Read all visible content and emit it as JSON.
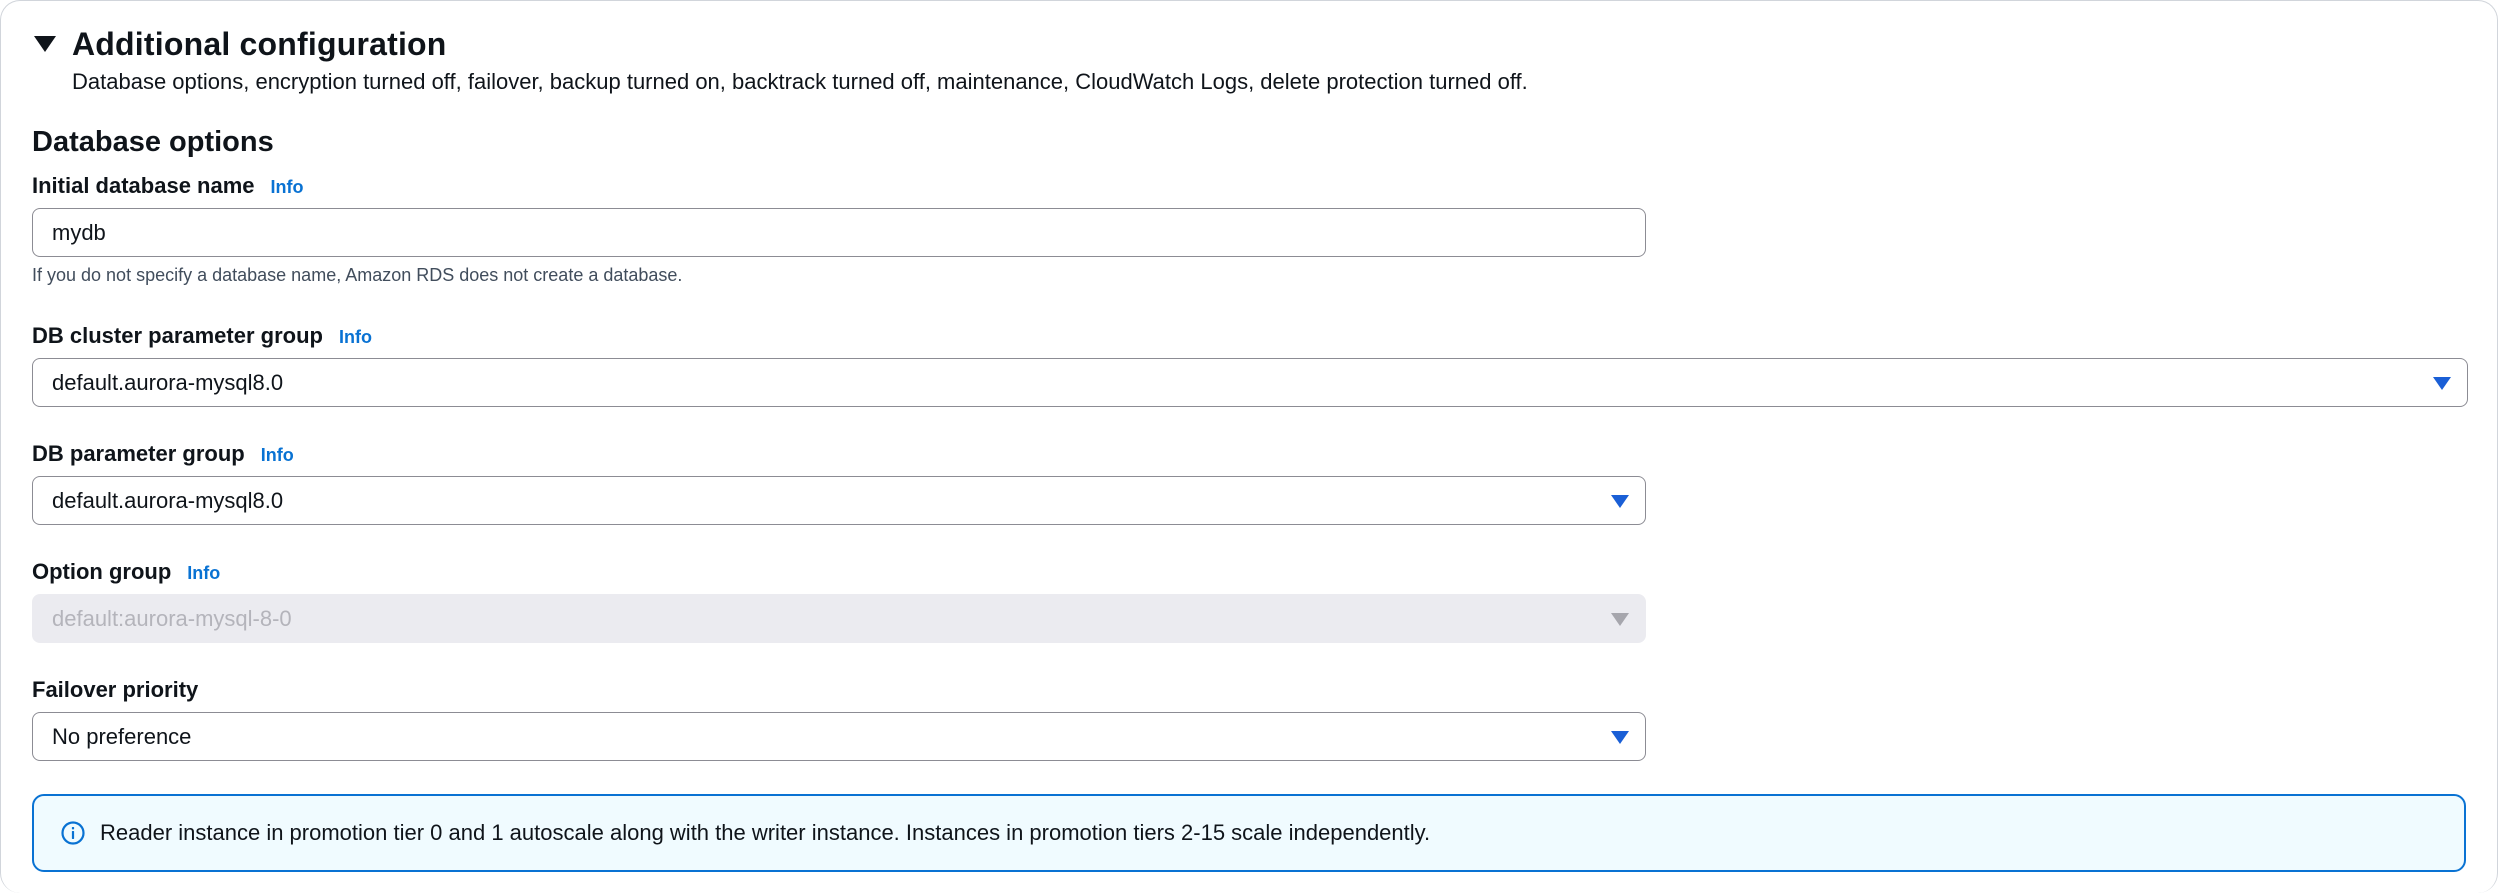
{
  "section": {
    "title": "Additional configuration",
    "description": "Database options, encryption turned off, failover, backup turned on, backtrack turned off, maintenance, CloudWatch Logs, delete protection turned off.",
    "expanded": true
  },
  "database_options": {
    "title": "Database options",
    "initial_db_name": {
      "label": "Initial database name",
      "info": "Info",
      "value": "mydb",
      "hint": "If you do not specify a database name, Amazon RDS does not create a database."
    },
    "cluster_param_group": {
      "label": "DB cluster parameter group",
      "info": "Info",
      "value": "default.aurora-mysql8.0"
    },
    "db_param_group": {
      "label": "DB parameter group",
      "info": "Info",
      "value": "default.aurora-mysql8.0"
    },
    "option_group": {
      "label": "Option group",
      "info": "Info",
      "value": "default:aurora-mysql-8-0",
      "disabled": true
    },
    "failover_priority": {
      "label": "Failover priority",
      "value": "No preference"
    }
  },
  "alert": {
    "icon": "info-circle-icon",
    "text": "Reader instance in promotion tier 0 and 1 autoscale along with the writer instance. Instances in promotion tiers 2-15 scale independently.",
    "color": "#0972d3"
  },
  "colors": {
    "link": "#0972d3",
    "select_caret": "#1a5fd6",
    "alert_bg": "#f0fbff"
  }
}
